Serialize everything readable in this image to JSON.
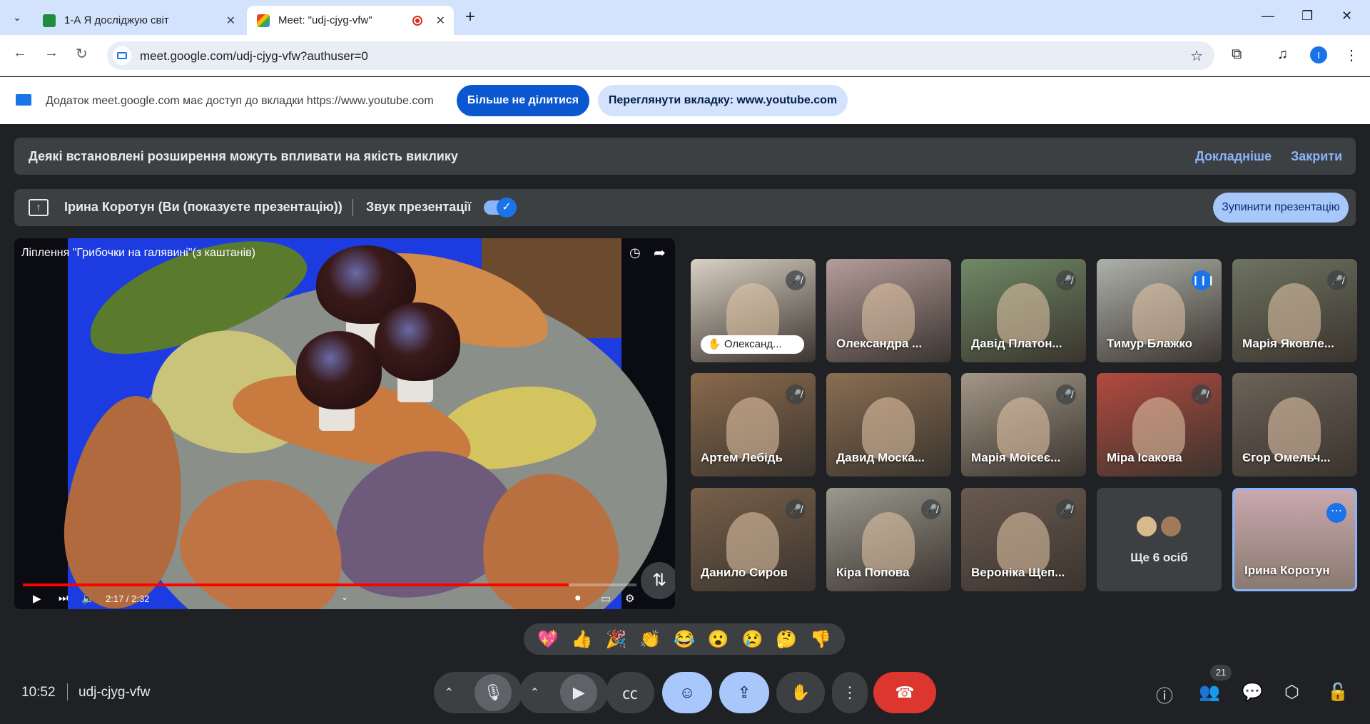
{
  "browser": {
    "tabs": [
      {
        "title": "1-А Я досліджую світ",
        "favicon_color": "#1e8e3e"
      },
      {
        "title": "Meet: \"udj-cjyg-vfw\"",
        "favicon_color": "#00832d",
        "recording_color": "#d93025"
      }
    ],
    "url": "meet.google.com/udj-cjyg-vfw?authuser=0",
    "profile_initial": "I"
  },
  "sharebar": {
    "text": "Додаток meet.google.com має доступ до вкладки https://www.youtube.com",
    "stop_label": "Більше не ділитися",
    "view_label": "Переглянути вкладку: www.youtube.com"
  },
  "banner": {
    "text": "Деякі встановлені розширення можуть впливати на якість виклику",
    "learn_more": "Докладніше",
    "close": "Закрити"
  },
  "presentation": {
    "presenter": "Ірина Коротун (Ви (показуєте презентацію))",
    "sound_label": "Звук презентації",
    "sound_on": true,
    "stop_label": "Зупинити презентацію"
  },
  "video": {
    "title": "Ліплення \"Грибочки на галявині\"(з каштанів)",
    "time": "2:17 / 2:32",
    "progress": 0.89
  },
  "participants": [
    {
      "name": "Олександ...",
      "bg": "#d9d1c4",
      "hand_raised": true,
      "muted": true
    },
    {
      "name": "Олександра ...",
      "bg": "#b59d9b",
      "muted": false
    },
    {
      "name": "Давід Платон...",
      "bg": "#6f8a66",
      "muted": true
    },
    {
      "name": "Тимур Блажко",
      "bg": "#aeb2aa",
      "speaking": true
    },
    {
      "name": "Марія Яковле...",
      "bg": "#6e7361",
      "muted": true
    },
    {
      "name": "Артем Лебідь",
      "bg": "#8b6a4c",
      "muted": true
    },
    {
      "name": "Давид Моска...",
      "bg": "#8a6e52",
      "muted": false
    },
    {
      "name": "Марія Моісеє...",
      "bg": "#a39787",
      "muted": true
    },
    {
      "name": "Міра Ісакова",
      "bg": "#b34a3f",
      "muted": true
    },
    {
      "name": "Єгор Омельч...",
      "bg": "#6c6258",
      "muted": false
    },
    {
      "name": "Данило Сиров",
      "bg": "#78604a",
      "muted": true
    },
    {
      "name": "Кіра Попова",
      "bg": "#9b9a8f",
      "muted": true
    },
    {
      "name": "Вероніка Щеп...",
      "bg": "#6a5a50",
      "muted": true
    }
  ],
  "others": {
    "label": "Ще 6 осіб"
  },
  "self": {
    "name": "Ірина Коротун",
    "bg": "#c9a8ae"
  },
  "reactions": [
    "💖",
    "👍",
    "🎉",
    "👏",
    "😂",
    "😮",
    "😢",
    "🤔",
    "👎"
  ],
  "bottom": {
    "time": "10:52",
    "meeting_code": "udj-cjyg-vfw",
    "participant_count": "21"
  }
}
